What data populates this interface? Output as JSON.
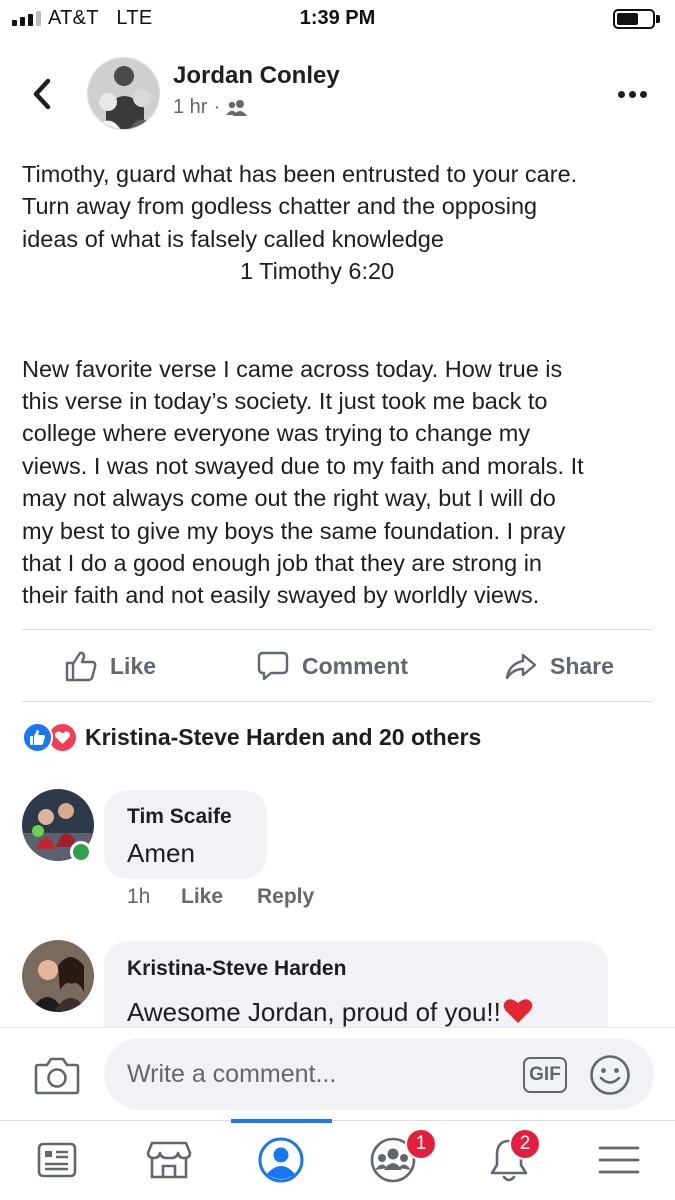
{
  "status_bar": {
    "carrier": "AT&T",
    "network": "LTE",
    "time": "1:39 PM"
  },
  "post": {
    "author": "Jordan Conley",
    "time_ago": "1 hr",
    "separator": "·",
    "audience_icon": "friends-icon",
    "verse_lines": [
      "Timothy, guard what has been entrusted to your care.",
      "Turn away from godless chatter and the opposing",
      "ideas of what is falsely called knowledge"
    ],
    "verse_reference": "1 Timothy 6:20",
    "body_lines": [
      "New favorite verse I came across today. How true is",
      "this verse in today’s society. It just took me back to",
      "college where everyone was trying to change my",
      "views. I was not swayed due to my faith and morals. It",
      "may not always come out the right way, but I will do",
      "my best to give my boys the same foundation. I pray",
      "that I do a good enough job that they are strong in",
      "their faith and not easily swayed by worldly views."
    ]
  },
  "actions": {
    "like": "Like",
    "comment": "Comment",
    "share": "Share"
  },
  "reactions": {
    "summary": "Kristina-Steve Harden and 20 others",
    "types": [
      "like-icon",
      "love-icon"
    ]
  },
  "comments": [
    {
      "name": "Tim Scaife",
      "text": "Amen",
      "time": "1h",
      "like_label": "Like",
      "reply_label": "Reply",
      "online": true
    },
    {
      "name": "Kristina-Steve Harden",
      "text": "Awesome Jordan, proud of you!!",
      "emoji": "heart-emoji"
    }
  ],
  "composer": {
    "placeholder": "Write a comment...",
    "gif_label": "GIF"
  },
  "tabbar": {
    "tabs": [
      {
        "name": "news-feed-icon"
      },
      {
        "name": "marketplace-icon"
      },
      {
        "name": "profile-icon",
        "active": true
      },
      {
        "name": "groups-icon",
        "badge": "1"
      },
      {
        "name": "notifications-icon",
        "badge": "2"
      },
      {
        "name": "menu-icon"
      }
    ]
  },
  "colors": {
    "accent": "#1877f2",
    "text": "#1c1e21",
    "secondary_text": "#65676b",
    "bubble": "#f0f2f5",
    "badge": "#e41e3f",
    "online": "#31a24c",
    "love": "#f33e58"
  }
}
